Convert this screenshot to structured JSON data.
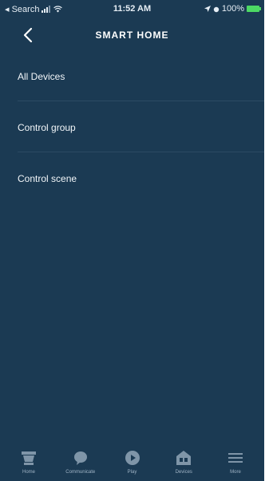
{
  "status_bar": {
    "back_app": "◂ Search",
    "time": "11:52 AM",
    "battery": "100%"
  },
  "header": {
    "title": "SMART HOME"
  },
  "menu": {
    "items": [
      {
        "label": "All Devices"
      },
      {
        "label": "Control group"
      },
      {
        "label": "Control scene"
      }
    ]
  },
  "bottom_nav": {
    "items": [
      {
        "label": "Home",
        "icon": "home-icon"
      },
      {
        "label": "Communicate",
        "icon": "chat-bubble-icon"
      },
      {
        "label": "Play",
        "icon": "play-icon"
      },
      {
        "label": "Devices",
        "icon": "devices-icon"
      },
      {
        "label": "More",
        "icon": "menu-icon"
      }
    ]
  },
  "colors": {
    "background": "#1b3a53",
    "divider": "#2c4a63",
    "nav_icon": "#7f95a8",
    "battery": "#4cd964"
  }
}
